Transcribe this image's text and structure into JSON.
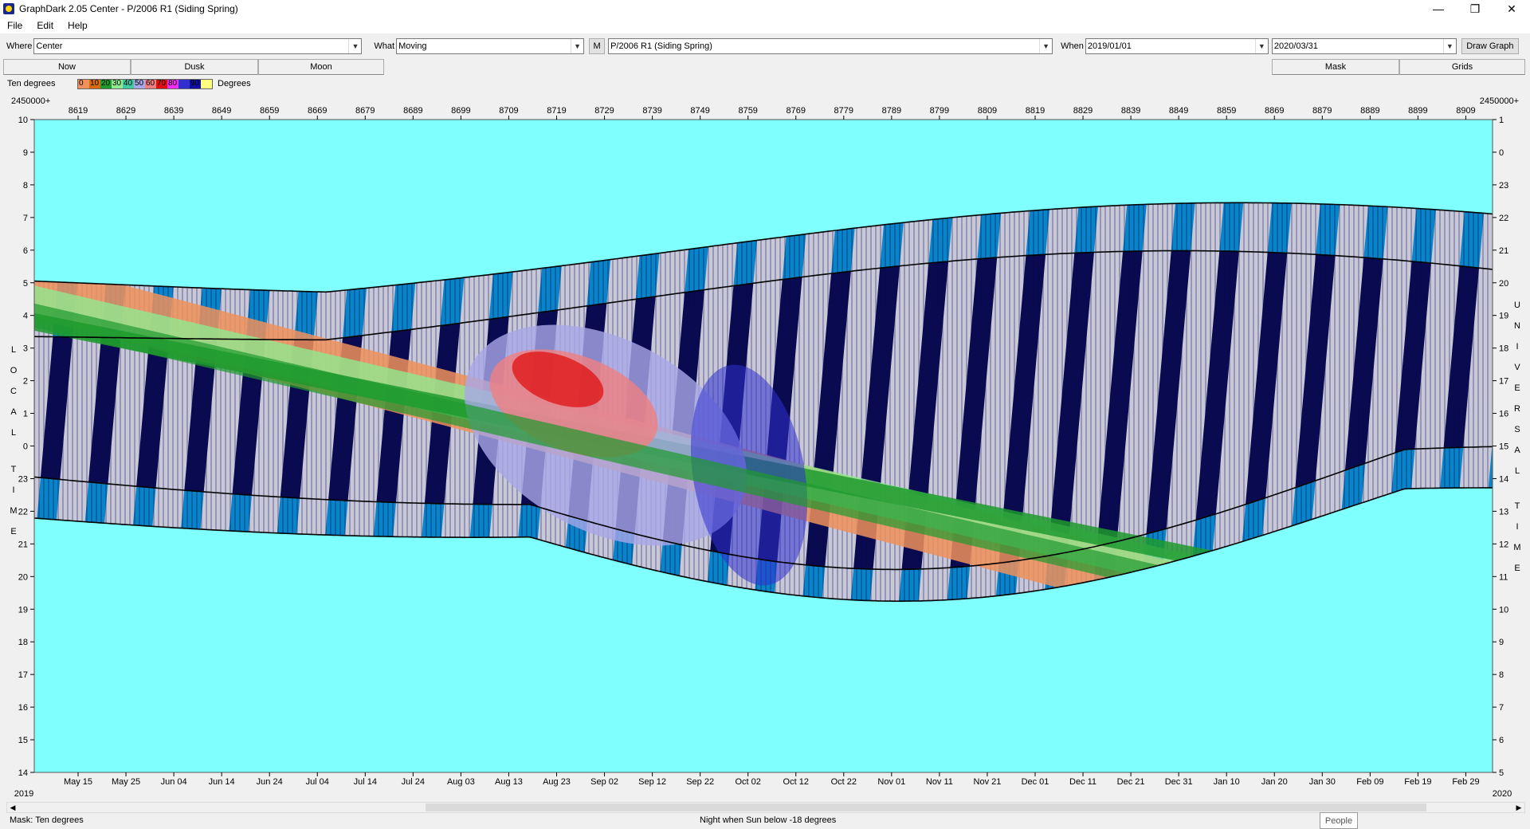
{
  "window": {
    "title": "GraphDark 2.05  Center  -  P/2006 R1 (Siding Spring)"
  },
  "menu": [
    "File",
    "Edit",
    "Help"
  ],
  "toolbar": {
    "where_label": "Where",
    "where_value": "Center",
    "what_label": "What",
    "what_value": "Moving",
    "m_button": "M",
    "object_value": "P/2006 R1 (Siding Spring)",
    "when_label": "When",
    "when_start": "2019/01/01",
    "when_end": "2020/03/31",
    "draw_button": "Draw Graph"
  },
  "tabs": {
    "now": "Now",
    "dusk": "Dusk",
    "moon": "Moon",
    "mask": "Mask",
    "grids": "Grids"
  },
  "legend": {
    "label": "Ten degrees",
    "unit": "Degrees",
    "swatches": [
      {
        "text": "0",
        "color": "#f0905a"
      },
      {
        "text": "10",
        "color": "#d86a10"
      },
      {
        "text": "20",
        "color": "#1e9a2e"
      },
      {
        "text": "30",
        "color": "#90e890"
      },
      {
        "text": "40",
        "color": "#40c8a0"
      },
      {
        "text": "50",
        "color": "#a8a8e8"
      },
      {
        "text": "60",
        "color": "#f08080"
      },
      {
        "text": "70",
        "color": "#e01010"
      },
      {
        "text": "80",
        "color": "#f030f0"
      },
      {
        "text": "",
        "color": "#3030d0"
      },
      {
        "text": "90",
        "color": "#1010a0"
      },
      {
        "text": "",
        "color": "#ffff80"
      }
    ]
  },
  "chart": {
    "jd_prefix": "2450000+",
    "jd_ticks": [
      "8619",
      "8629",
      "8639",
      "8649",
      "8659",
      "8669",
      "8679",
      "8689",
      "8699",
      "8709",
      "8719",
      "8729",
      "8739",
      "8749",
      "8759",
      "8769",
      "8779",
      "8789",
      "8799",
      "8809",
      "8819",
      "8829",
      "8839",
      "8849",
      "8859",
      "8869",
      "8879",
      "8889",
      "8899",
      "8909"
    ],
    "date_ticks": [
      "May 15",
      "May 25",
      "Jun 04",
      "Jun 14",
      "Jun 24",
      "Jul 04",
      "Jul 14",
      "Jul 24",
      "Aug 03",
      "Aug 13",
      "Aug 23",
      "Sep 02",
      "Sep 12",
      "Sep 22",
      "Oct 02",
      "Oct 12",
      "Oct 22",
      "Nov 01",
      "Nov 11",
      "Nov 21",
      "Dec 01",
      "Dec 11",
      "Dec 21",
      "Dec 31",
      "Jan 10",
      "Jan 20",
      "Jan 30",
      "Feb 09",
      "Feb 19",
      "Feb 29"
    ],
    "year_left": "2019",
    "year_right": "2020",
    "local_ticks": [
      "10",
      "9",
      "8",
      "7",
      "6",
      "5",
      "4",
      "3",
      "2",
      "1",
      "0",
      "23",
      "22",
      "21",
      "20",
      "19",
      "18",
      "17",
      "16",
      "15",
      "14"
    ],
    "ut_ticks": [
      "1",
      "0",
      "23",
      "22",
      "21",
      "20",
      "19",
      "18",
      "17",
      "16",
      "15",
      "14",
      "13",
      "12",
      "11",
      "10",
      "9",
      "8",
      "7",
      "6",
      "5"
    ],
    "left_axis_title": "LOCAL TIME",
    "right_axis_title": "UNIVERSAL TIME",
    "colors": {
      "day": "#80ffff",
      "night": "#0a0a50",
      "moon": "#c8c8d8",
      "twilight": "#0a84c8"
    }
  },
  "status": {
    "mask": "Mask:  Ten degrees",
    "night": "Night when Sun below -18 degrees",
    "people": "People"
  }
}
